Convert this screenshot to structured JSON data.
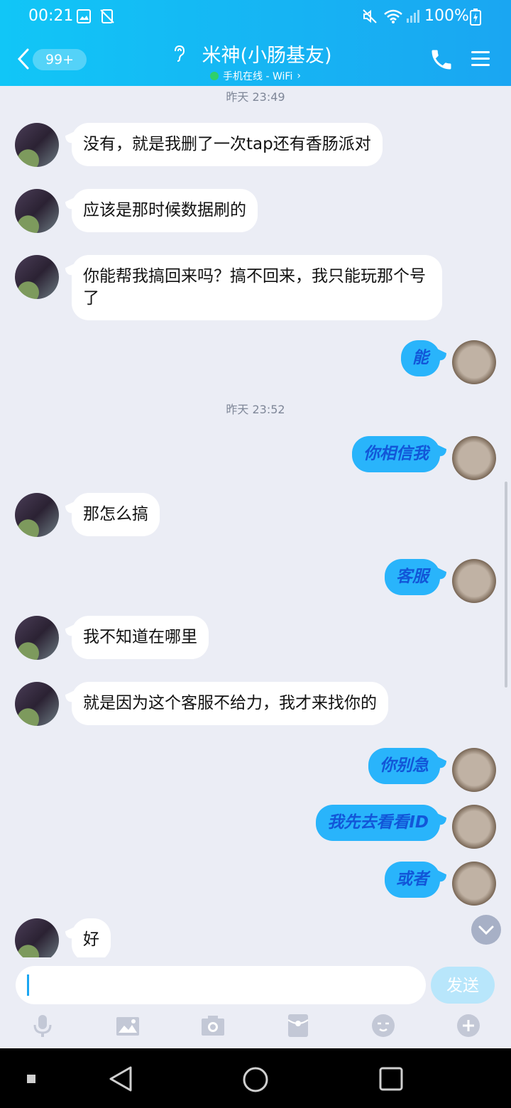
{
  "status_bar": {
    "time": "00:21",
    "battery": "100%"
  },
  "header": {
    "back_badge": "99+",
    "title": "米神(小肠基友)",
    "subtitle": "手机在线 - WiFi",
    "subtitle_chevron": "›"
  },
  "timestamps": [
    "昨天 23:49",
    "昨天 23:52"
  ],
  "messages": [
    {
      "side": "left",
      "text": "没有，就是我删了一次tap还有香肠派对"
    },
    {
      "side": "left",
      "text": "应该是那时候数据刷的"
    },
    {
      "side": "left",
      "text": "你能帮我搞回来吗？搞不回来，我只能玩那个号了"
    },
    {
      "side": "right",
      "text": "能"
    },
    {
      "side": "right",
      "text": "你相信我"
    },
    {
      "side": "left",
      "text": "那怎么搞"
    },
    {
      "side": "right",
      "text": "客服"
    },
    {
      "side": "left",
      "text": "我不知道在哪里"
    },
    {
      "side": "left",
      "text": "就是因为这个客服不给力，我才来找你的"
    },
    {
      "side": "right",
      "text": "你别急"
    },
    {
      "side": "right",
      "text": "我先去看看ID"
    },
    {
      "side": "right",
      "text": "或者"
    },
    {
      "side": "left",
      "text": "好"
    }
  ],
  "input": {
    "placeholder": "",
    "send_label": "发送"
  },
  "colors": {
    "accent": "#1aa6f2",
    "bubble_right": "#29b4fb",
    "bubble_right_text": "#1256d8",
    "online": "#2fd06a"
  },
  "icons": {
    "status": [
      "image-icon",
      "sync-off-icon",
      "mute-icon",
      "wifi-icon",
      "signal-icon",
      "battery-charging-icon"
    ],
    "toolbar": [
      "microphone-icon",
      "picture-icon",
      "camera-icon",
      "red-packet-icon",
      "emoji-icon",
      "plus-icon"
    ],
    "android_nav": [
      "recent-square-small-icon",
      "back-triangle-icon",
      "home-circle-icon",
      "overview-square-icon"
    ]
  }
}
